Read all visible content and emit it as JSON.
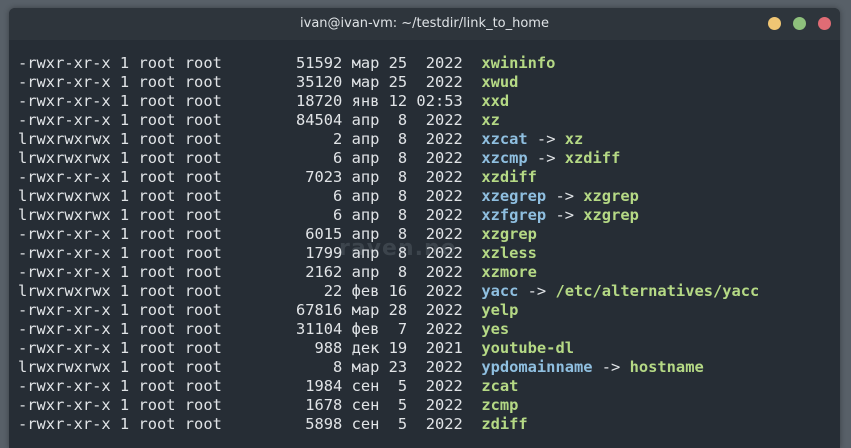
{
  "window": {
    "title": "ivan@ivan-vm: ~/testdir/link_to_home",
    "buttons": {
      "minimize": {
        "color": "#f0c674"
      },
      "maximize": {
        "color": "#8ec07c"
      },
      "close": {
        "color": "#e06c75"
      }
    }
  },
  "colors": {
    "file": "#b5d985",
    "symlink": "#8fbfe0",
    "text": "#e1e4e7",
    "background": "#262d35"
  },
  "watermark": "raven.ne",
  "listing": [
    {
      "perms": "-rwxr-xr-x",
      "links": "1",
      "owner": "root",
      "group": "root",
      "size": "51592",
      "month": "мар",
      "day": "25",
      "time": "2022",
      "name": "xwininfo",
      "kind": "file",
      "target": ""
    },
    {
      "perms": "-rwxr-xr-x",
      "links": "1",
      "owner": "root",
      "group": "root",
      "size": "35120",
      "month": "мар",
      "day": "25",
      "time": "2022",
      "name": "xwud",
      "kind": "file",
      "target": ""
    },
    {
      "perms": "-rwxr-xr-x",
      "links": "1",
      "owner": "root",
      "group": "root",
      "size": "18720",
      "month": "янв",
      "day": "12",
      "time": "02:53",
      "name": "xxd",
      "kind": "file",
      "target": ""
    },
    {
      "perms": "-rwxr-xr-x",
      "links": "1",
      "owner": "root",
      "group": "root",
      "size": "84504",
      "month": "апр",
      "day": "8",
      "time": "2022",
      "name": "xz",
      "kind": "file",
      "target": ""
    },
    {
      "perms": "lrwxrwxrwx",
      "links": "1",
      "owner": "root",
      "group": "root",
      "size": "2",
      "month": "апр",
      "day": "8",
      "time": "2022",
      "name": "xzcat",
      "kind": "symlink",
      "target": "xz"
    },
    {
      "perms": "lrwxrwxrwx",
      "links": "1",
      "owner": "root",
      "group": "root",
      "size": "6",
      "month": "апр",
      "day": "8",
      "time": "2022",
      "name": "xzcmp",
      "kind": "symlink",
      "target": "xzdiff"
    },
    {
      "perms": "-rwxr-xr-x",
      "links": "1",
      "owner": "root",
      "group": "root",
      "size": "7023",
      "month": "апр",
      "day": "8",
      "time": "2022",
      "name": "xzdiff",
      "kind": "file",
      "target": ""
    },
    {
      "perms": "lrwxrwxrwx",
      "links": "1",
      "owner": "root",
      "group": "root",
      "size": "6",
      "month": "апр",
      "day": "8",
      "time": "2022",
      "name": "xzegrep",
      "kind": "symlink",
      "target": "xzgrep"
    },
    {
      "perms": "lrwxrwxrwx",
      "links": "1",
      "owner": "root",
      "group": "root",
      "size": "6",
      "month": "апр",
      "day": "8",
      "time": "2022",
      "name": "xzfgrep",
      "kind": "symlink",
      "target": "xzgrep"
    },
    {
      "perms": "-rwxr-xr-x",
      "links": "1",
      "owner": "root",
      "group": "root",
      "size": "6015",
      "month": "апр",
      "day": "8",
      "time": "2022",
      "name": "xzgrep",
      "kind": "file",
      "target": ""
    },
    {
      "perms": "-rwxr-xr-x",
      "links": "1",
      "owner": "root",
      "group": "root",
      "size": "1799",
      "month": "апр",
      "day": "8",
      "time": "2022",
      "name": "xzless",
      "kind": "file",
      "target": ""
    },
    {
      "perms": "-rwxr-xr-x",
      "links": "1",
      "owner": "root",
      "group": "root",
      "size": "2162",
      "month": "апр",
      "day": "8",
      "time": "2022",
      "name": "xzmore",
      "kind": "file",
      "target": ""
    },
    {
      "perms": "lrwxrwxrwx",
      "links": "1",
      "owner": "root",
      "group": "root",
      "size": "22",
      "month": "фев",
      "day": "16",
      "time": "2022",
      "name": "yacc",
      "kind": "symlink",
      "target": "/etc/alternatives/yacc"
    },
    {
      "perms": "-rwxr-xr-x",
      "links": "1",
      "owner": "root",
      "group": "root",
      "size": "67816",
      "month": "мар",
      "day": "28",
      "time": "2022",
      "name": "yelp",
      "kind": "file",
      "target": ""
    },
    {
      "perms": "-rwxr-xr-x",
      "links": "1",
      "owner": "root",
      "group": "root",
      "size": "31104",
      "month": "фев",
      "day": "7",
      "time": "2022",
      "name": "yes",
      "kind": "file",
      "target": ""
    },
    {
      "perms": "-rwxr-xr-x",
      "links": "1",
      "owner": "root",
      "group": "root",
      "size": "988",
      "month": "дек",
      "day": "19",
      "time": "2021",
      "name": "youtube-dl",
      "kind": "file",
      "target": ""
    },
    {
      "perms": "lrwxrwxrwx",
      "links": "1",
      "owner": "root",
      "group": "root",
      "size": "8",
      "month": "мар",
      "day": "23",
      "time": "2022",
      "name": "ypdomainname",
      "kind": "symlink",
      "target": "hostname"
    },
    {
      "perms": "-rwxr-xr-x",
      "links": "1",
      "owner": "root",
      "group": "root",
      "size": "1984",
      "month": "сен",
      "day": "5",
      "time": "2022",
      "name": "zcat",
      "kind": "file",
      "target": ""
    },
    {
      "perms": "-rwxr-xr-x",
      "links": "1",
      "owner": "root",
      "group": "root",
      "size": "1678",
      "month": "сен",
      "day": "5",
      "time": "2022",
      "name": "zcmp",
      "kind": "file",
      "target": ""
    },
    {
      "perms": "-rwxr-xr-x",
      "links": "1",
      "owner": "root",
      "group": "root",
      "size": "5898",
      "month": "сен",
      "day": "5",
      "time": "2022",
      "name": "zdiff",
      "kind": "file",
      "target": ""
    }
  ]
}
